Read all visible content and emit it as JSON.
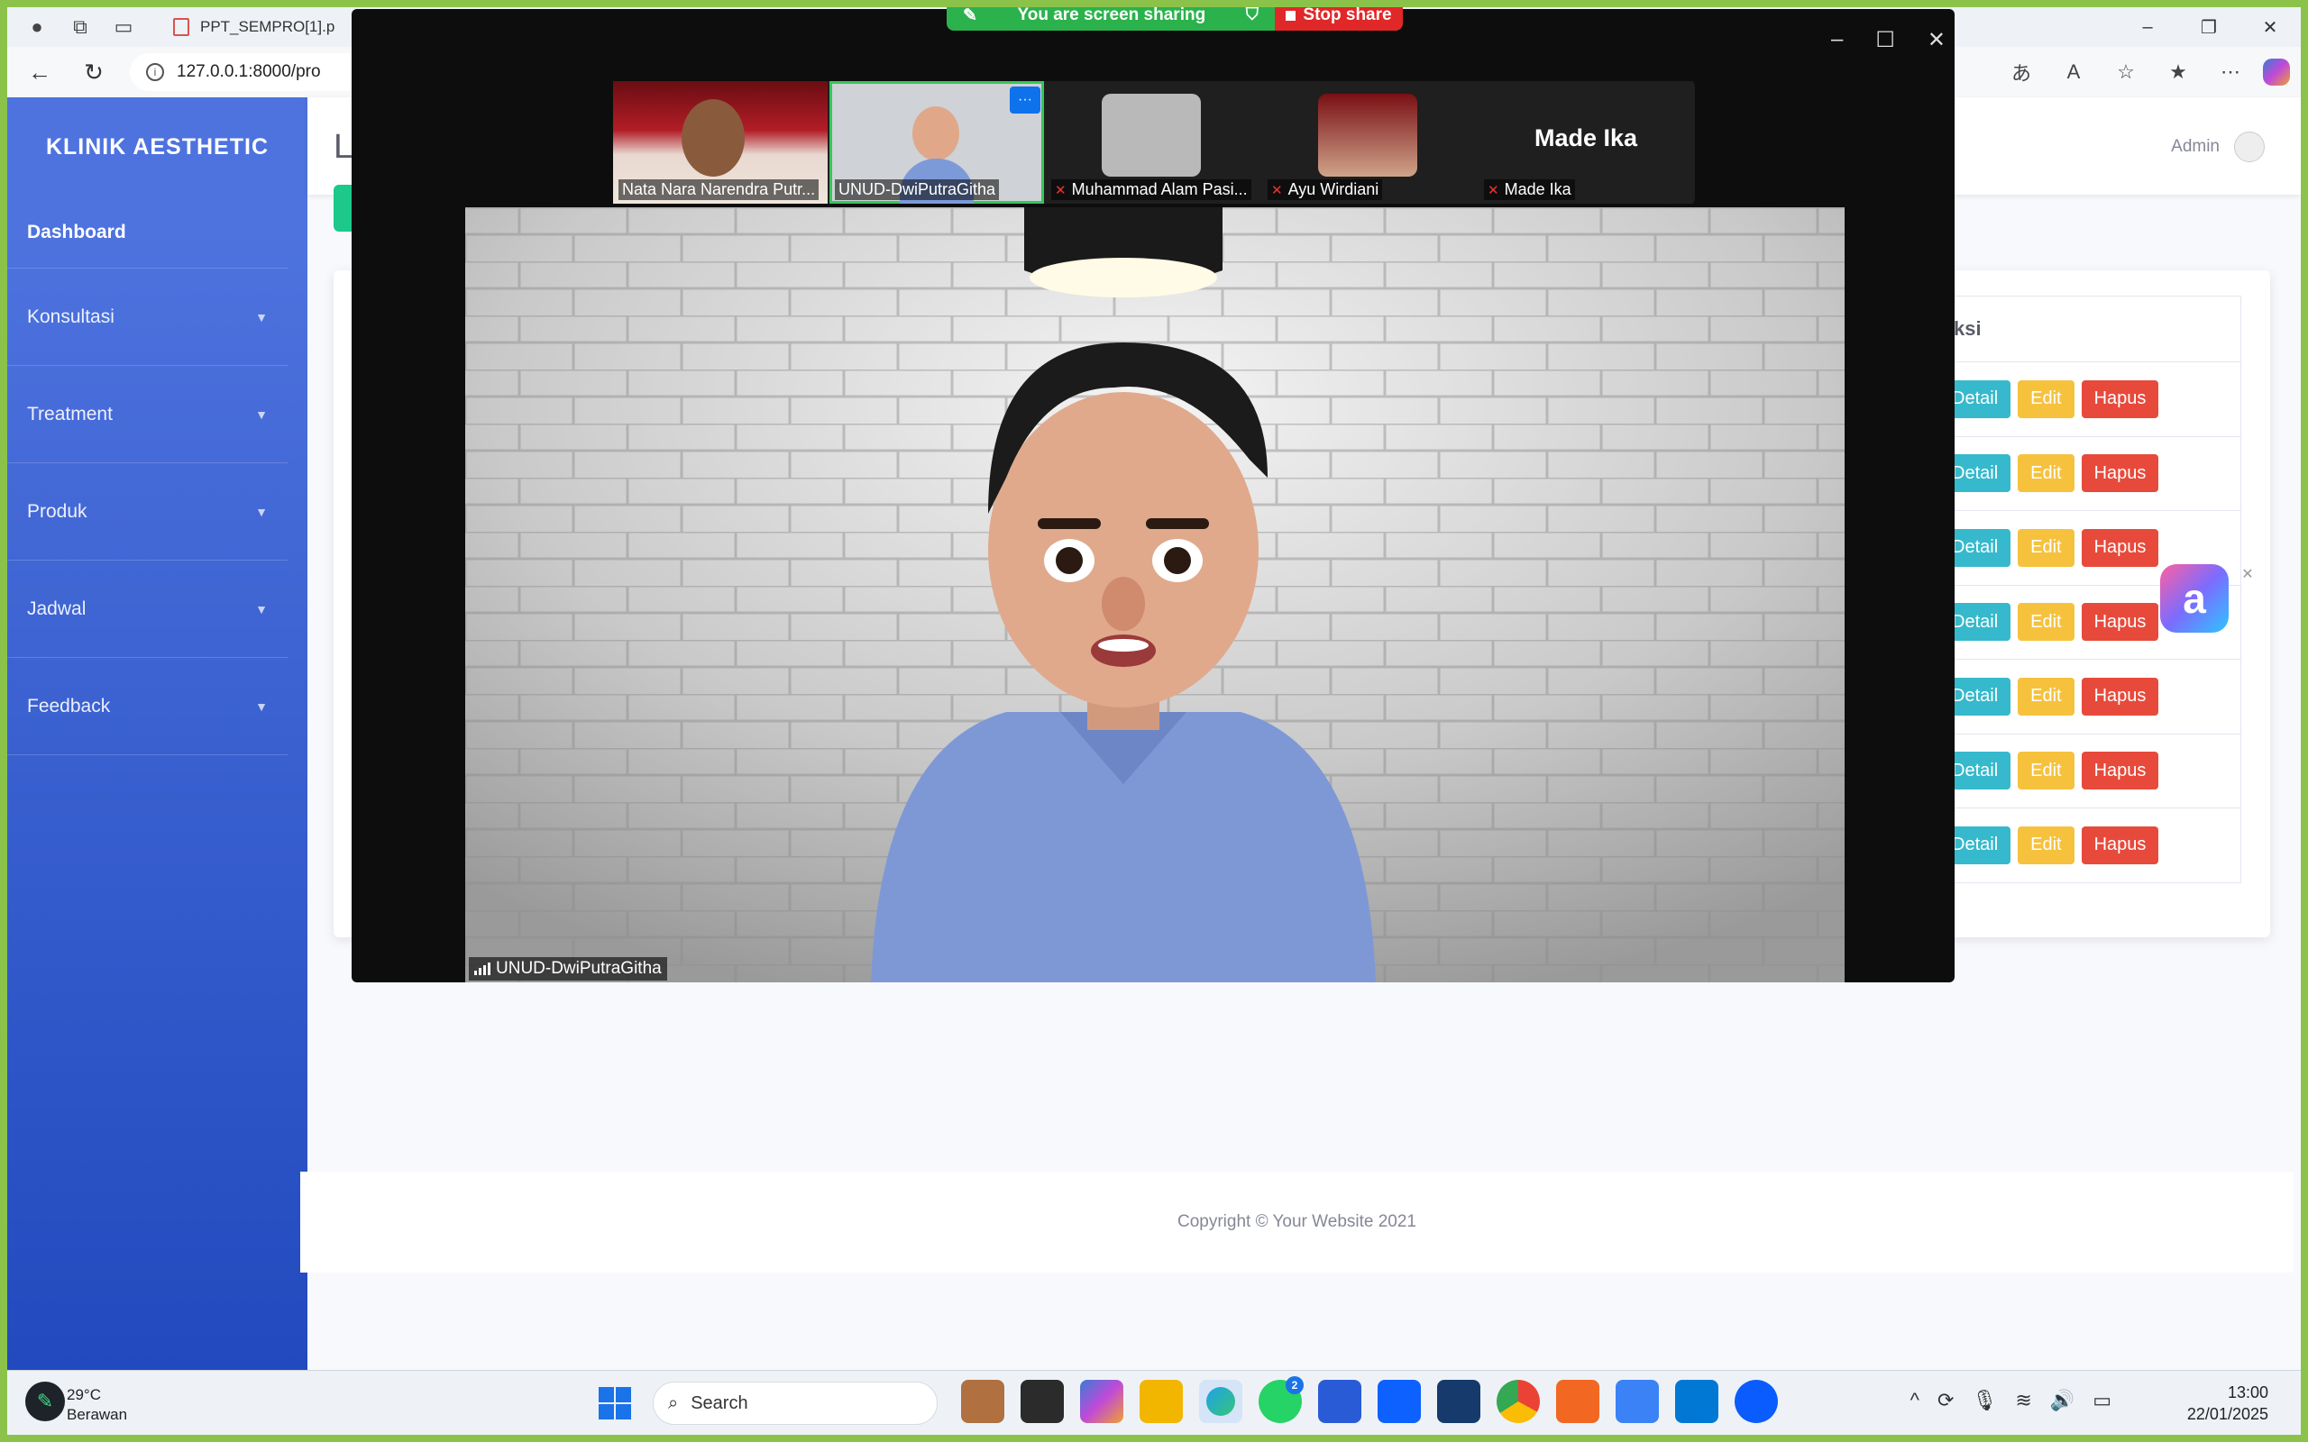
{
  "browser": {
    "tab_title": "PPT_SEMPRO[1].p",
    "url": "127.0.0.1:8000/pro"
  },
  "zoom": {
    "share_status": "You are screen sharing",
    "stop_label": "Stop share",
    "participants": [
      {
        "name": "Nata Nara Narendra Putr...",
        "muted": false
      },
      {
        "name": "UNUD-DwiPutraGitha",
        "muted": false
      },
      {
        "name": "Muhammad Alam Pasi...",
        "muted": true
      },
      {
        "name": "Ayu Wirdiani",
        "muted": true
      },
      {
        "name": "Made Ika",
        "muted": true
      }
    ],
    "big_name": "Made Ika",
    "speaker_name": "UNUD-DwiPutraGitha"
  },
  "app": {
    "brand": "KLINIK AESTHETIC",
    "nav": {
      "dashboard": "Dashboard",
      "konsultasi": "Konsultasi",
      "treatment": "Treatment",
      "produk": "Produk",
      "jadwal": "Jadwal",
      "feedback": "Feedback"
    },
    "user": "Admin",
    "heading": "L",
    "table_header": "ksi",
    "actions": {
      "detail": "Detail",
      "edit": "Edit",
      "hapus": "Hapus"
    },
    "row_count": 7,
    "footer": "Copyright © Your Website 2021"
  },
  "taskbar": {
    "temperature": "29°C",
    "weather": "Berawan",
    "search": "Search",
    "whatsapp_badge": "2",
    "time": "13:00",
    "date": "22/01/2025"
  },
  "colors": {
    "sidebar_top": "#4e73df",
    "sidebar_bottom": "#224abe",
    "detail": "#36b9cc",
    "edit": "#f6c23e",
    "hapus": "#e74a3b",
    "share_green": "#2bb24c",
    "stop_red": "#e02828"
  }
}
